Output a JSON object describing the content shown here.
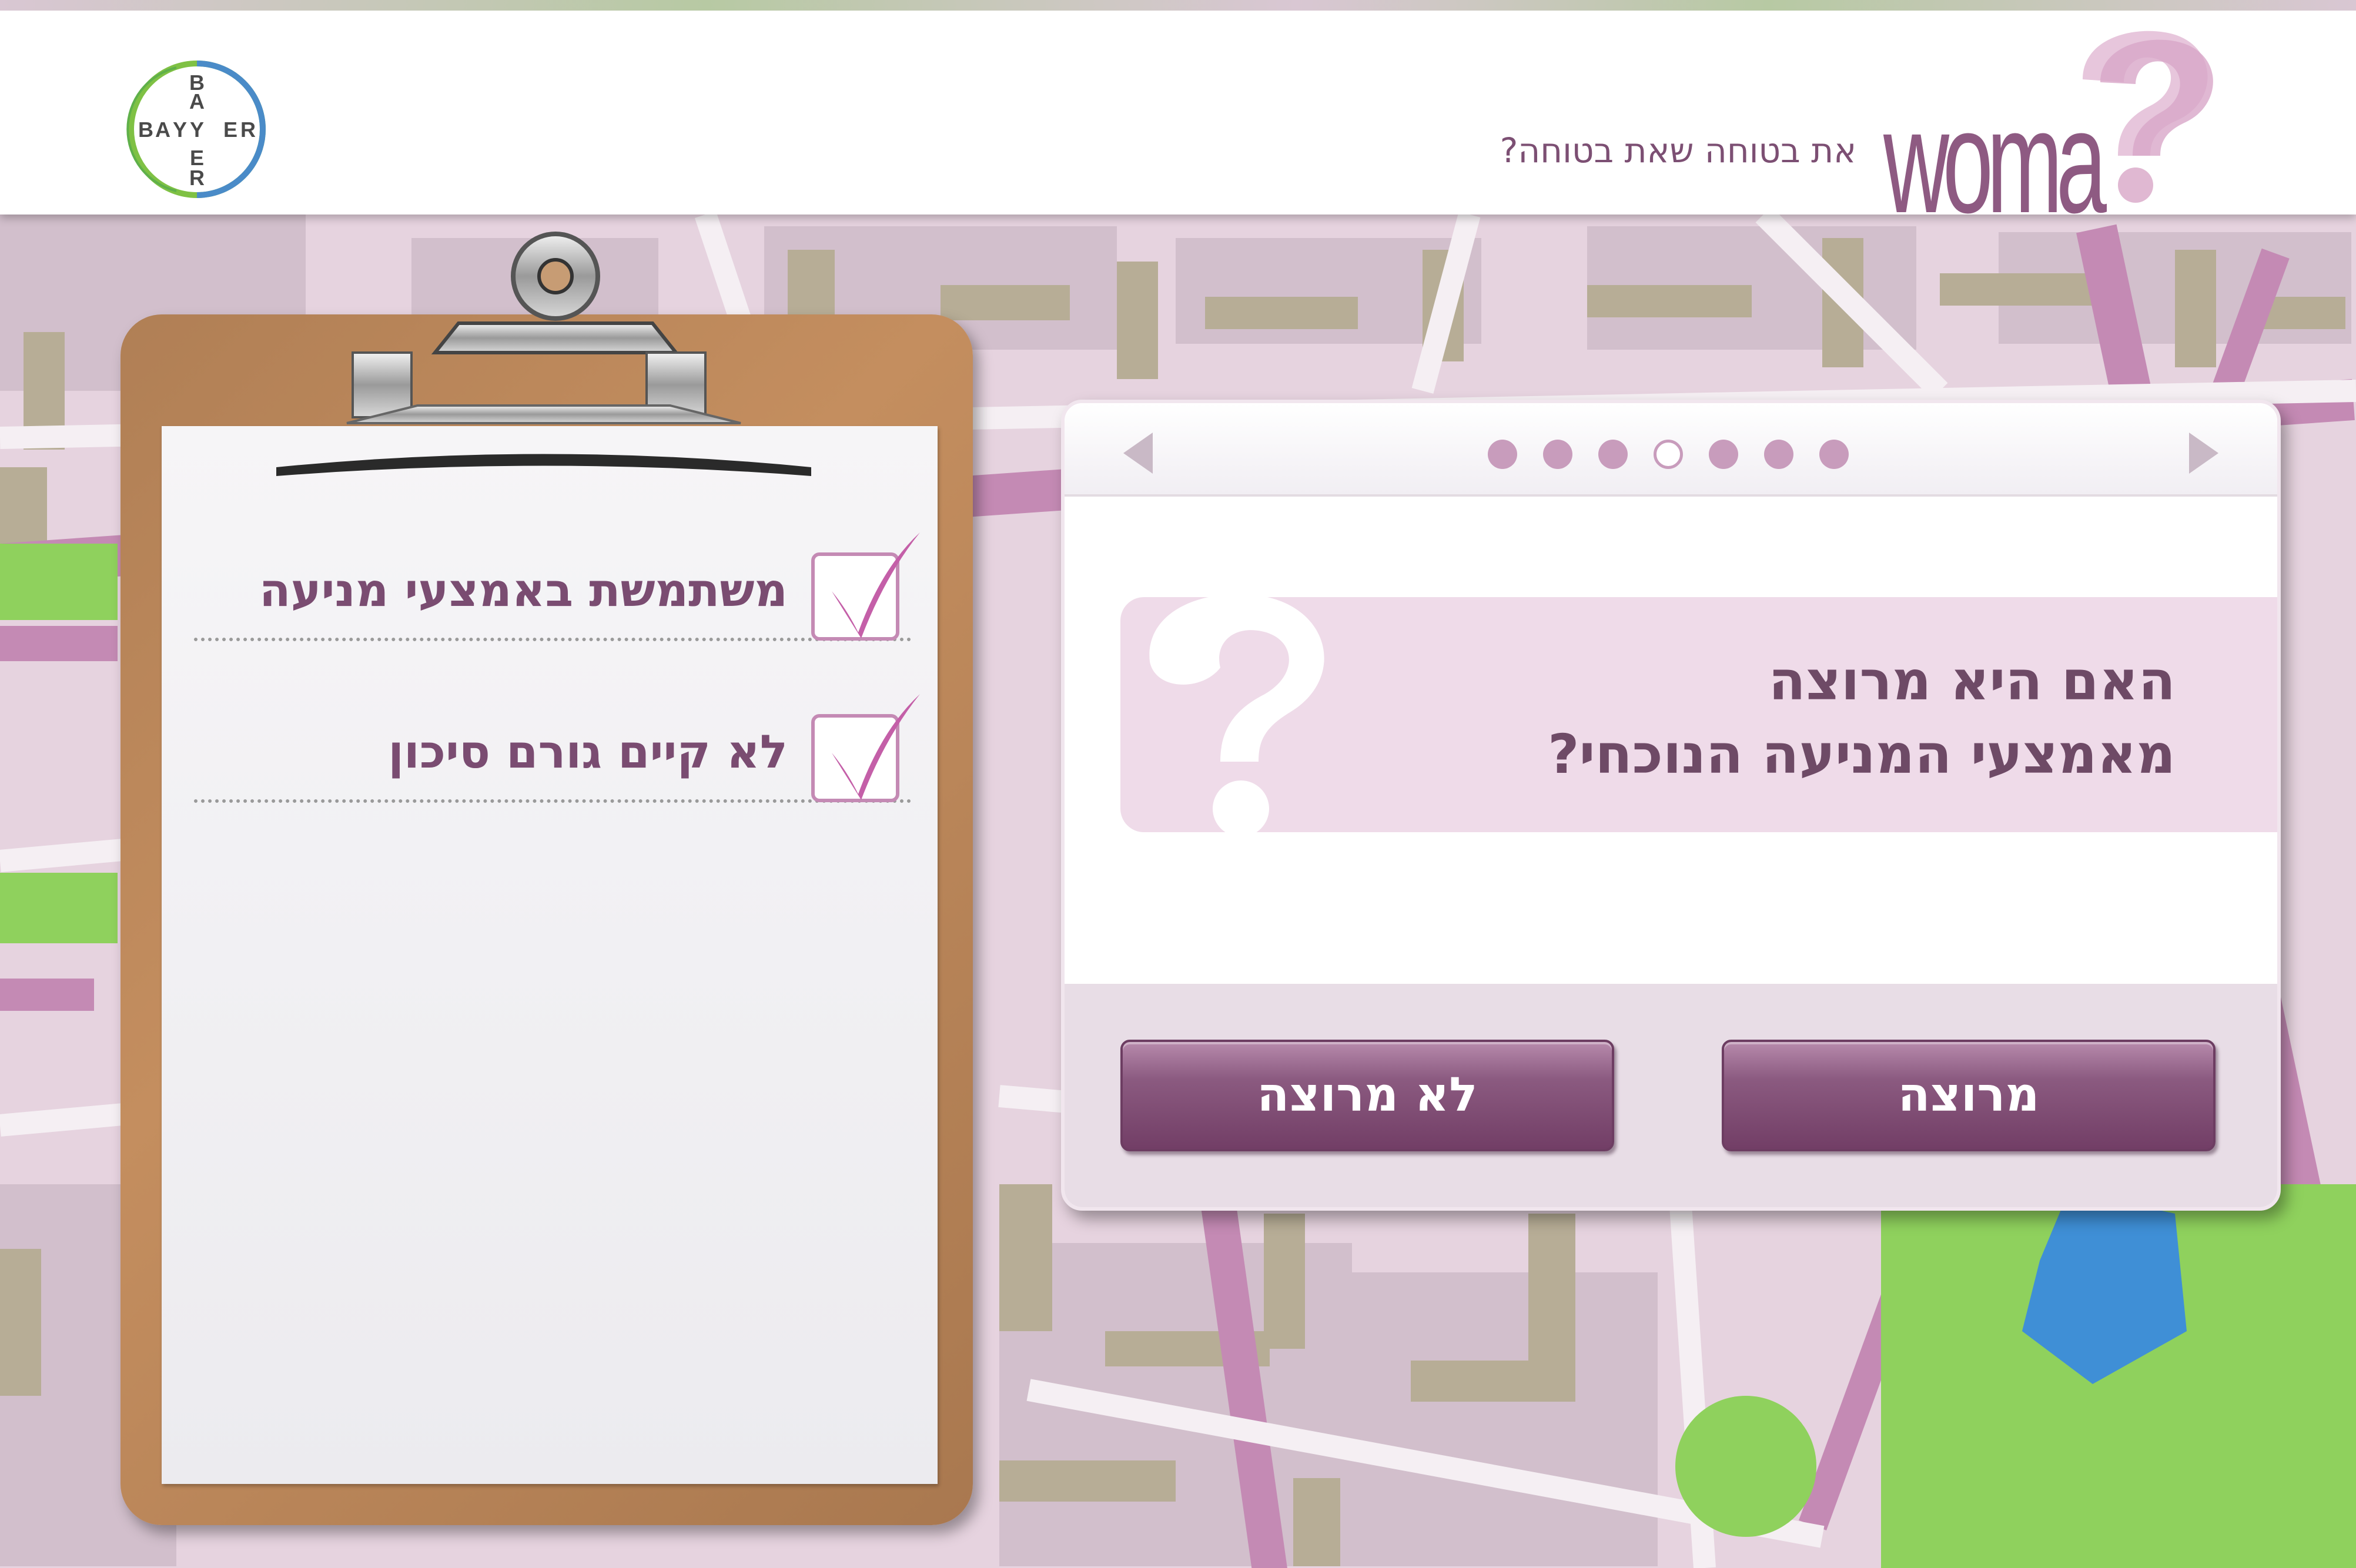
{
  "header": {
    "brand": "woma",
    "tagline": "את בטוחה שאת בטוחה?",
    "logo_text": "BAYER"
  },
  "clipboard": {
    "items": [
      {
        "label": "משתמשת באמצעי מניעה",
        "checked": true
      },
      {
        "label": "לא קיים גורם סיכון",
        "checked": true
      }
    ]
  },
  "question_panel": {
    "nav": {
      "total_steps": 7,
      "current_step": 4
    },
    "question_line1": "האם היא מרוצה",
    "question_line2": "מאמצעי המניעה הנוכחי?",
    "buttons": {
      "not_satisfied": "לא מרוצה",
      "satisfied": "מרוצה"
    }
  },
  "colors": {
    "accent": "#7a4c71",
    "button": "#7f4b74",
    "highlight": "#efdbe9",
    "check": "#c45fa8"
  }
}
